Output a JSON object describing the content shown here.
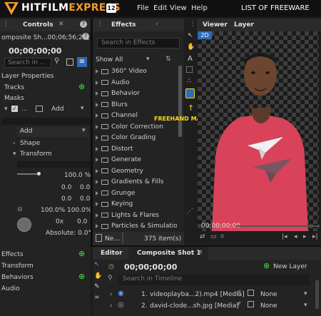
{
  "app": {
    "name_part1": "HITFILM",
    "name_part2": "EXPRESS",
    "version": "12"
  },
  "menu": [
    "File",
    "Edit",
    "View",
    "Help"
  ],
  "overlay_title": "LIST OF FREEWARE",
  "controls": {
    "tab": "Controls",
    "comp_name": "omposite Sh...00;06;56;20]",
    "timecode": "00;00;00;00",
    "search_placeholder": "Search in ...",
    "layer_properties": "Layer Properties",
    "tracks": "Tracks",
    "masks": "Masks",
    "mask_mode": "Add",
    "add_dropdown": "Add",
    "shape": "Shape",
    "transform": "Transform",
    "opacity": "100.0 %",
    "pos_x": "0.0",
    "pos_y": "0.0",
    "anchor_x": "0.0",
    "anchor_y": "0.0",
    "scale_x": "100.0%",
    "scale_y": "100.0%",
    "rot_turns": "0x",
    "rot_deg": "0.0",
    "absolute": "Absolute: 0.0°",
    "effects": "Effects",
    "transform2": "Transform",
    "behaviors": "Behaviors",
    "audio": "Audio"
  },
  "effects_panel": {
    "tab": "Effects",
    "search_placeholder": "Search in Effects",
    "show_all": "Show All",
    "categories": [
      "360° Video",
      "Audio",
      "Behavior",
      "Blurs",
      "Channel",
      "Color Correction",
      "Color Grading",
      "Distort",
      "Generate",
      "Geometry",
      "Gradients & Fills",
      "Grunge",
      "Keying",
      "Lights & Flares",
      "Particles & Simulation"
    ],
    "new_label": "Ne...",
    "count": "375 item(s)"
  },
  "viewer": {
    "tabs": [
      "Viewer",
      "Layer"
    ],
    "badge": "2D",
    "timecode": "00;00;00;00",
    "annotation": "FREEHAND MASK TOOL"
  },
  "timeline": {
    "tabs": [
      "Editor",
      "Composite Shot 1"
    ],
    "timecode": "00;00;00;00",
    "new_layer": "New Layer",
    "search_placeholder": "Search in Timeline",
    "layers": [
      {
        "num": "1.",
        "name": "videoplayba...2).mp4 [Media]",
        "blend": "None"
      },
      {
        "num": "2.",
        "name": "david-clode...sh.jpg [Media]",
        "blend": "None"
      }
    ]
  },
  "colors": {
    "accent": "#f29a2e",
    "green": "#3fbf3f",
    "viewer_tab_active": "#2d6bb5",
    "annotation": "#f5d91a"
  }
}
